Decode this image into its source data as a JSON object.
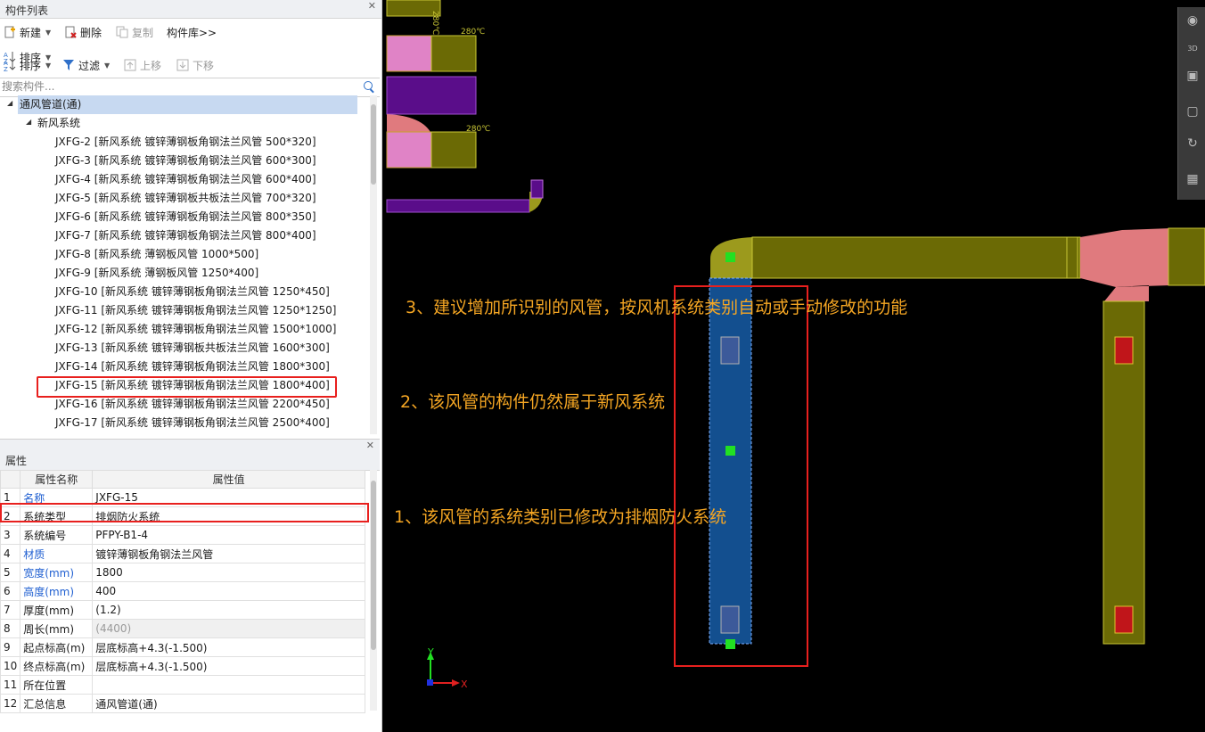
{
  "components_panel": {
    "title": "构件列表",
    "toolbar_row1": {
      "new": "新建",
      "delete": "删除",
      "copy": "复制",
      "library": "构件库>>"
    },
    "toolbar_row2": {
      "sort": "排序",
      "filter": "过滤",
      "move_up": "上移",
      "move_down": "下移"
    },
    "search_placeholder": "搜索构件...",
    "tree": {
      "root": "通风管道(通)",
      "group": "新风系统",
      "items": [
        "JXFG-2 [新风系统 镀锌薄钢板角钢法兰风管 500*320]",
        "JXFG-3 [新风系统 镀锌薄钢板角钢法兰风管 600*300]",
        "JXFG-4 [新风系统 镀锌薄钢板角钢法兰风管 600*400]",
        "JXFG-5 [新风系统 镀锌薄钢板共板法兰风管 700*320]",
        "JXFG-6 [新风系统 镀锌薄钢板角钢法兰风管 800*350]",
        "JXFG-7 [新风系统 镀锌薄钢板角钢法兰风管 800*400]",
        "JXFG-8 [新风系统 薄钢板风管 1000*500]",
        "JXFG-9 [新风系统 薄钢板风管 1250*400]",
        "JXFG-10 [新风系统 镀锌薄钢板角钢法兰风管 1250*450]",
        "JXFG-11 [新风系统 镀锌薄钢板角钢法兰风管 1250*1250]",
        "JXFG-12 [新风系统 镀锌薄钢板角钢法兰风管 1500*1000]",
        "JXFG-13 [新风系统 镀锌薄钢板共板法兰风管 1600*300]",
        "JXFG-14 [新风系统 镀锌薄钢板角钢法兰风管 1800*300]",
        "JXFG-15 [新风系统 镀锌薄钢板角钢法兰风管 1800*400]",
        "JXFG-16 [新风系统 镀锌薄钢板角钢法兰风管 2200*450]",
        "JXFG-17 [新风系统 镀锌薄钢板角钢法兰风管 2500*400]"
      ]
    }
  },
  "properties_panel": {
    "title": "属性",
    "col_name": "属性名称",
    "col_value": "属性值",
    "rows": [
      {
        "num": "1",
        "name": "名称",
        "value": "JXFG-15"
      },
      {
        "num": "2",
        "name": "系统类型",
        "value": "排烟防火系统"
      },
      {
        "num": "3",
        "name": "系统编号",
        "value": "PFPY-B1-4"
      },
      {
        "num": "4",
        "name": "材质",
        "value": "镀锌薄钢板角钢法兰风管"
      },
      {
        "num": "5",
        "name": "宽度(mm)",
        "value": "1800"
      },
      {
        "num": "6",
        "name": "高度(mm)",
        "value": "400"
      },
      {
        "num": "7",
        "name": "厚度(mm)",
        "value": "(1.2)"
      },
      {
        "num": "8",
        "name": "周长(mm)",
        "value": "(4400)"
      },
      {
        "num": "9",
        "name": "起点标高(m)",
        "value": "层底标高+4.3(-1.500)"
      },
      {
        "num": "10",
        "name": "终点标高(m)",
        "value": "层底标高+4.3(-1.500)"
      },
      {
        "num": "11",
        "name": "所在位置",
        "value": ""
      },
      {
        "num": "12",
        "name": "汇总信息",
        "value": "通风管道(通)"
      }
    ]
  },
  "canvas": {
    "annotations": {
      "a3": "3、建议增加所识别的风管，按风机系统类别自动或手动修改的功能",
      "a2": "2、该风管的构件仍然属于新风系统",
      "a1": "1、该风管的系统类别已修改为排烟防火系统"
    },
    "temp_labels": [
      "280℃",
      "280℃",
      "280℃"
    ],
    "axis": {
      "x": "X",
      "y": "Y"
    },
    "view_tools": [
      "3D"
    ]
  },
  "colors": {
    "annotation": "#f5a623",
    "highlight_box": "#e8201e",
    "duct_olive": "#6b6a05",
    "duct_blue": "#134f8f",
    "duct_purple": "#5a0d8a",
    "duct_pink": "#e07a7e"
  }
}
